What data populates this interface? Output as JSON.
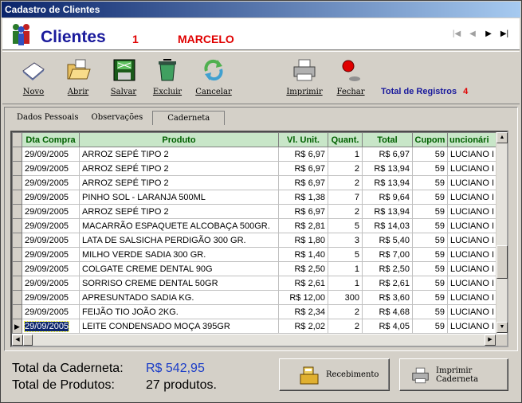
{
  "window": {
    "title": "Cadastro de Clientes"
  },
  "header": {
    "title": "Clientes",
    "client_code": "1",
    "client_name": "MARCELO",
    "nav": [
      "|◀",
      "◀",
      "▶",
      "▶|"
    ]
  },
  "toolbar": {
    "new_label": "Novo",
    "open_label": "Abrir",
    "save_label": "Salvar",
    "delete_label": "Excluir",
    "cancel_label": "Cancelar",
    "print_label": "Imprimir",
    "close_label": "Fechar",
    "total_records_label": "Total de Registros",
    "total_records_value": "4"
  },
  "tabs": [
    "Dados Pessoais",
    "Observações",
    "Caderneta"
  ],
  "grid": {
    "columns": [
      "Dta Compra",
      "Produto",
      "Vl. Unit.",
      "Quant.",
      "Total",
      "Cupom",
      "uncionári"
    ],
    "rows": [
      [
        "29/09/2005",
        "ARROZ SEPÉ TIPO 2",
        "R$ 6,97",
        "1",
        "R$ 6,97",
        "59",
        "LUCIANO I"
      ],
      [
        "29/09/2005",
        "ARROZ SEPÉ TIPO 2",
        "R$ 6,97",
        "2",
        "R$ 13,94",
        "59",
        "LUCIANO I"
      ],
      [
        "29/09/2005",
        "ARROZ SEPÉ TIPO 2",
        "R$ 6,97",
        "2",
        "R$ 13,94",
        "59",
        "LUCIANO I"
      ],
      [
        "29/09/2005",
        "PINHO SOL - LARANJA 500ML",
        "R$ 1,38",
        "7",
        "R$ 9,64",
        "59",
        "LUCIANO I"
      ],
      [
        "29/09/2005",
        "ARROZ SEPÉ TIPO 2",
        "R$ 6,97",
        "2",
        "R$ 13,94",
        "59",
        "LUCIANO I"
      ],
      [
        "29/09/2005",
        "MACARRÃO ESPAQUETE ALCOBAÇA 500GR.",
        "R$ 2,81",
        "5",
        "R$ 14,03",
        "59",
        "LUCIANO I"
      ],
      [
        "29/09/2005",
        "LATA DE SALSICHA PERDIGÃO 300 GR.",
        "R$ 1,80",
        "3",
        "R$ 5,40",
        "59",
        "LUCIANO I"
      ],
      [
        "29/09/2005",
        "MILHO VERDE SADIA 300 GR.",
        "R$ 1,40",
        "5",
        "R$ 7,00",
        "59",
        "LUCIANO I"
      ],
      [
        "29/09/2005",
        "COLGATE CREME DENTAL 90G",
        "R$ 2,50",
        "1",
        "R$ 2,50",
        "59",
        "LUCIANO I"
      ],
      [
        "29/09/2005",
        "SORRISO CREME DENTAL 50GR",
        "R$ 2,61",
        "1",
        "R$ 2,61",
        "59",
        "LUCIANO I"
      ],
      [
        "29/09/2005",
        "APRESUNTADO SADIA KG.",
        "R$ 12,00",
        "300",
        "R$ 3,60",
        "59",
        "LUCIANO I"
      ],
      [
        "29/09/2005",
        "FEIJÃO TIO JOÃO 2KG.",
        "R$ 2,34",
        "2",
        "R$ 4,68",
        "59",
        "LUCIANO I"
      ],
      [
        "29/09/2005",
        "LEITE CONDENSADO MOÇA 395GR",
        "R$ 2,02",
        "2",
        "R$ 4,05",
        "59",
        "LUCIANO I"
      ]
    ]
  },
  "summary": {
    "total_caderneta_label": "Total da Caderneta:",
    "total_caderneta_value": "R$ 542,95",
    "total_produtos_label": "Total de Produtos:",
    "total_produtos_value": "27 produtos."
  },
  "buttons": {
    "receive_label": "Recebimento",
    "print_label": "Imprimir Caderneta"
  },
  "colors": {
    "title_blue": "#1a1a9c",
    "accent_red": "#e00000",
    "header_green": "#c8e6c8",
    "selection": "#0a246a",
    "total_value": "#1a3cc8"
  }
}
